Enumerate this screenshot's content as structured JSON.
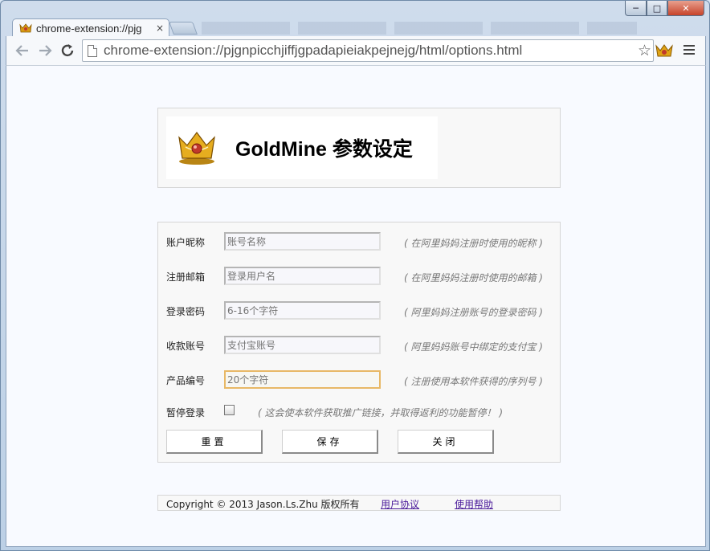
{
  "browser": {
    "tab_title": "chrome-extension://pjg",
    "tab_close": "×",
    "url": "chrome-extension://pjgnpicchjiffjgpadapieiakpejnejg/html/options.html",
    "icons": {
      "back": "arrow-left-icon",
      "forward": "arrow-right-icon",
      "reload": "reload-icon",
      "star": "star-icon",
      "menu": "hamburger-menu-icon",
      "extension": "goldmine-extension-icon"
    }
  },
  "window_controls": {
    "minimize": "─",
    "maximize": "□",
    "close": "✕"
  },
  "header": {
    "title": "GoldMine 参数设定"
  },
  "form": {
    "rows": [
      {
        "label": "账户昵称",
        "placeholder": "账号名称",
        "hint": "( 在阿里妈妈注册时使用的昵称 )"
      },
      {
        "label": "注册邮箱",
        "placeholder": "登录用户名",
        "hint": "( 在阿里妈妈注册时使用的邮箱 )"
      },
      {
        "label": "登录密码",
        "placeholder": "6-16个字符",
        "hint": "( 阿里妈妈注册账号的登录密码 )"
      },
      {
        "label": "收款账号",
        "placeholder": "支付宝账号",
        "hint": "( 阿里妈妈账号中绑定的支付宝 )"
      },
      {
        "label": "产品编号",
        "placeholder": "20个字符",
        "hint": "( 注册使用本软件获得的序列号 )"
      }
    ],
    "pause": {
      "label": "暂停登录",
      "checked": false,
      "hint": "( 这会使本软件获取推广链接，并取得返利的功能暂停！ )"
    },
    "buttons": {
      "reset": "重置",
      "save": "保存",
      "close": "关闭"
    }
  },
  "footer": {
    "copyright": "Copyright © 2013 Jason.Ls.Zhu 版权所有",
    "agreement_link": "用户协议",
    "help_link": "使用帮助"
  },
  "colors": {
    "focus_border": "#e8b866",
    "link": "#4a1a9a",
    "hint": "#777777"
  }
}
